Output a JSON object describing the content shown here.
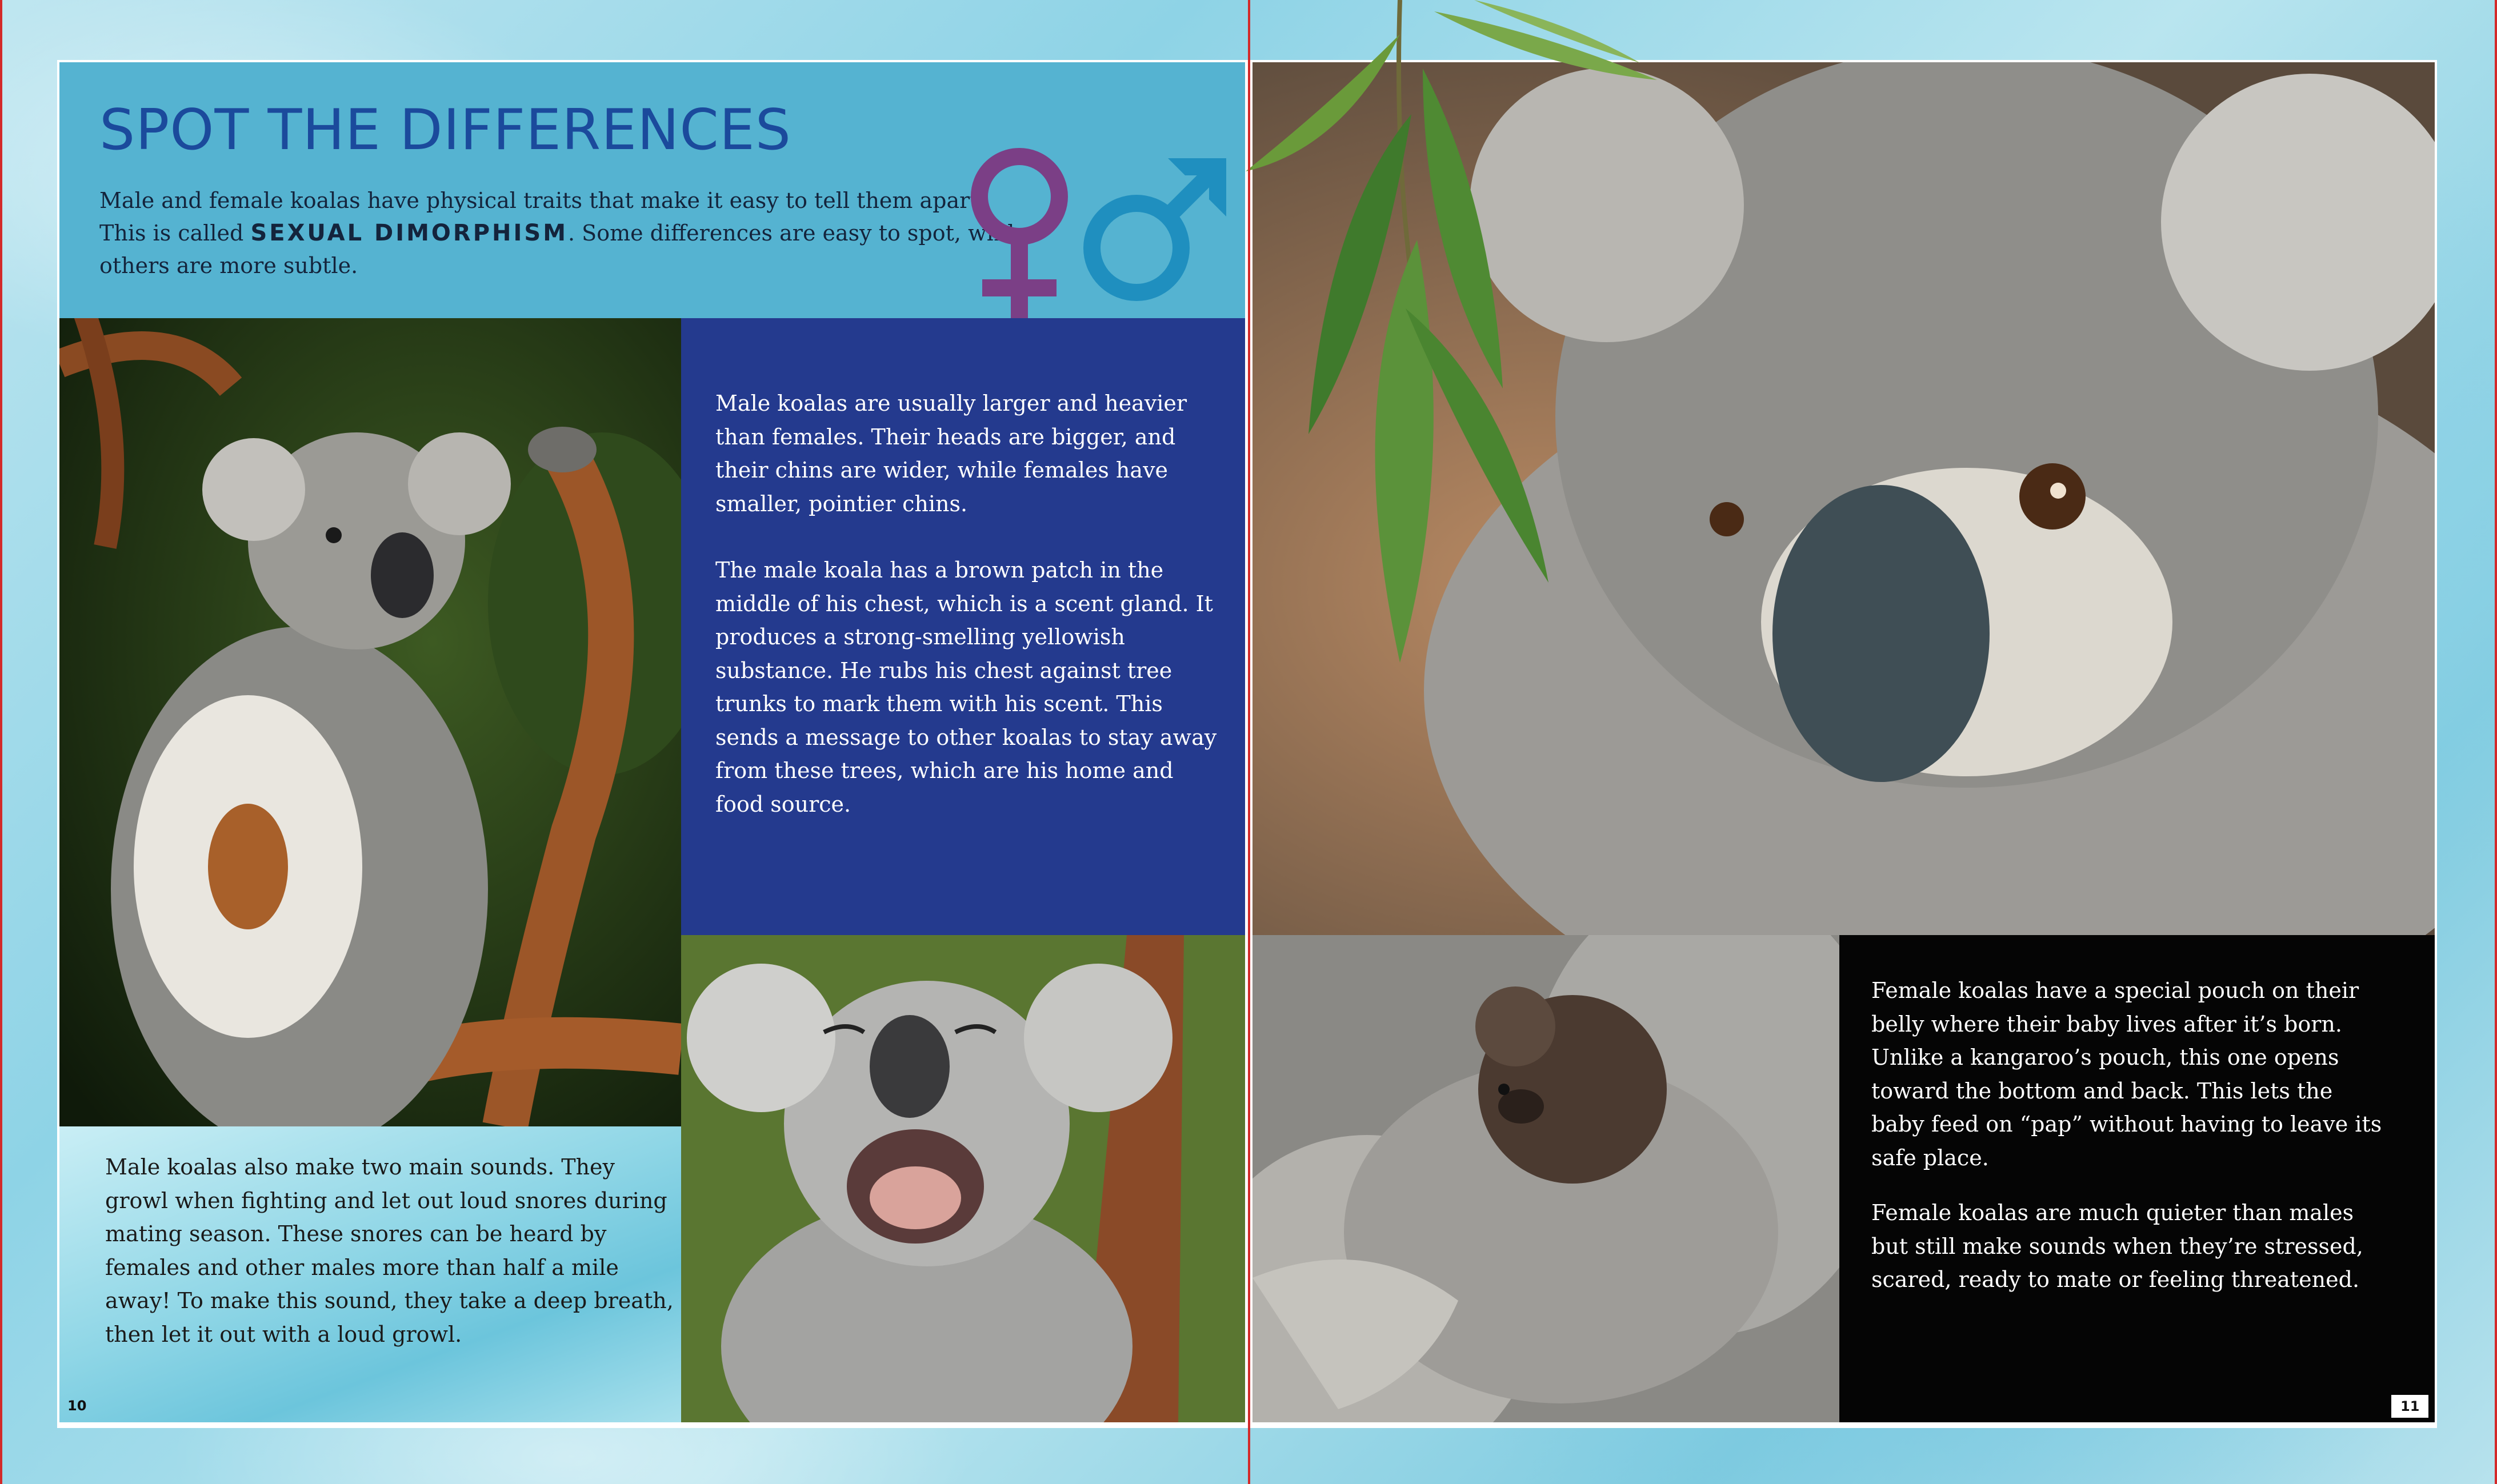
{
  "left_page": {
    "title": "SPOT THE DIFFERENCES",
    "intro_before": "Male and female koalas have physical traits that make it easy to tell them apart. This is called ",
    "intro_term": "SEXUAL DIMORPHISM",
    "intro_after": ". Some differences are easy to spot, while others are more subtle.",
    "symbols": {
      "female_color": "#7b3f86",
      "male_color": "#1f8fbf"
    },
    "size_paragraph": "Male koalas are usually larger and heavier than females. Their heads are bigger, and their chins are wider, while females have smaller, pointier chins.",
    "scent_paragraph": "The male koala has a brown patch in the middle of his chest, which is a scent gland. It produces a strong-smelling yellowish substance. He rubs his chest against tree trunks to mark them with his scent. This sends a message to other koalas to stay away from these trees, which are his home and food source.",
    "sounds_paragraph": "Male koalas also make two main sounds. They growl when fighting and let out loud snores during mating season. These snores can be heard by females and other males more than half a mile away! To make this sound, they take a deep breath, then let it out with a loud growl.",
    "page_number": "10"
  },
  "right_page": {
    "pouch_paragraph": "Female koalas have a special pouch on their belly where their baby lives after it’s born. Unlike a kangaroo’s pouch, this one opens toward the bottom and back. This lets the baby feed on “pap” without having to leave its safe place.",
    "quiet_paragraph": "Female koalas are much quieter than males but still make sounds when they’re stressed, scared, ready to mate or feeling threatened.",
    "page_number": "11"
  },
  "colors": {
    "header_bg": "#55b3d1",
    "title": "#1b4a9c",
    "navy_panel": "#243a8e",
    "black_panel": "#050505",
    "page_edge": "#d32a2a"
  }
}
